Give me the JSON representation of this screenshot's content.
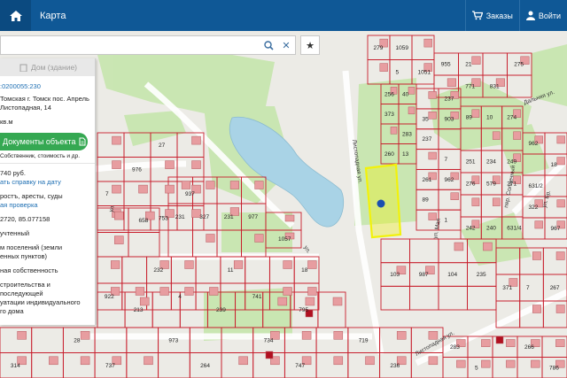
{
  "header": {
    "map_tab_label": "Карта",
    "orders_label": "Заказы",
    "login_label": "Войти"
  },
  "search": {
    "value": "",
    "placeholder": ""
  },
  "panel": {
    "tab_label": "Дом (здание)",
    "cadastral_number": ":0200055:230",
    "address_line1": "Томская г. Томск пос. Апрель",
    "address_line2": "Листопадная, 14",
    "area_text": "кв.м",
    "docs_button_label": "Документы объекта",
    "docs_subtitle": "Собственник, стоимость и др.",
    "price_text": "740 руб.",
    "cert_link": "ать справку на дату",
    "rights_text": "ростъ, аресты, суды",
    "check_link": "ая проверка",
    "coords_text": "2720, 85.077158",
    "status_text": "учтенный",
    "category_line1": "м поселений (земли",
    "category_line2": "енных пунктов)",
    "ownership_text": "ная собственность",
    "usage_line1": "строительства и последующей",
    "usage_line2": "уатации индивидуального",
    "usage_line3": "го дома"
  },
  "map": {
    "colors": {
      "background": "#ecebe6",
      "green": "#c8e6b0",
      "water": "#a9d3e6",
      "parcel_line": "#c81e2d",
      "building": "#e79da0",
      "highlight": "#f2f20a",
      "marker": "#1a4fb0"
    },
    "streets": [
      "Листопадная ул.",
      "ул. Мая",
      "Дальняя ул.",
      "пер. Солнечный",
      "ул.",
      "ул.",
      "ул. Бр.",
      "Листопадная ул."
    ],
    "parcel_labels": [
      "279",
      "5",
      "955",
      "771",
      "275",
      "373",
      "40",
      "13",
      "237",
      "89",
      "903",
      "962",
      "89",
      "276",
      "10",
      "579",
      "274",
      "271",
      "962",
      "322",
      "18",
      "967",
      "7",
      "976",
      "27",
      "753",
      "937",
      "231",
      "327",
      "231",
      "977",
      "922",
      "232",
      "4",
      "11",
      "741",
      "18",
      "213",
      "239",
      "795",
      "103",
      "987",
      "104",
      "235",
      "371",
      "7",
      "267",
      "314",
      "28",
      "737",
      "973",
      "264",
      "734",
      "747",
      "719",
      "236",
      "283",
      "5",
      "266",
      "786",
      "658",
      "1057",
      "1059",
      "1051",
      "21",
      "831",
      "256",
      "260",
      "283",
      "35",
      "261",
      "237",
      "7",
      "1",
      "251",
      "242",
      "234",
      "240",
      "249",
      "631/4",
      "631/2"
    ]
  }
}
